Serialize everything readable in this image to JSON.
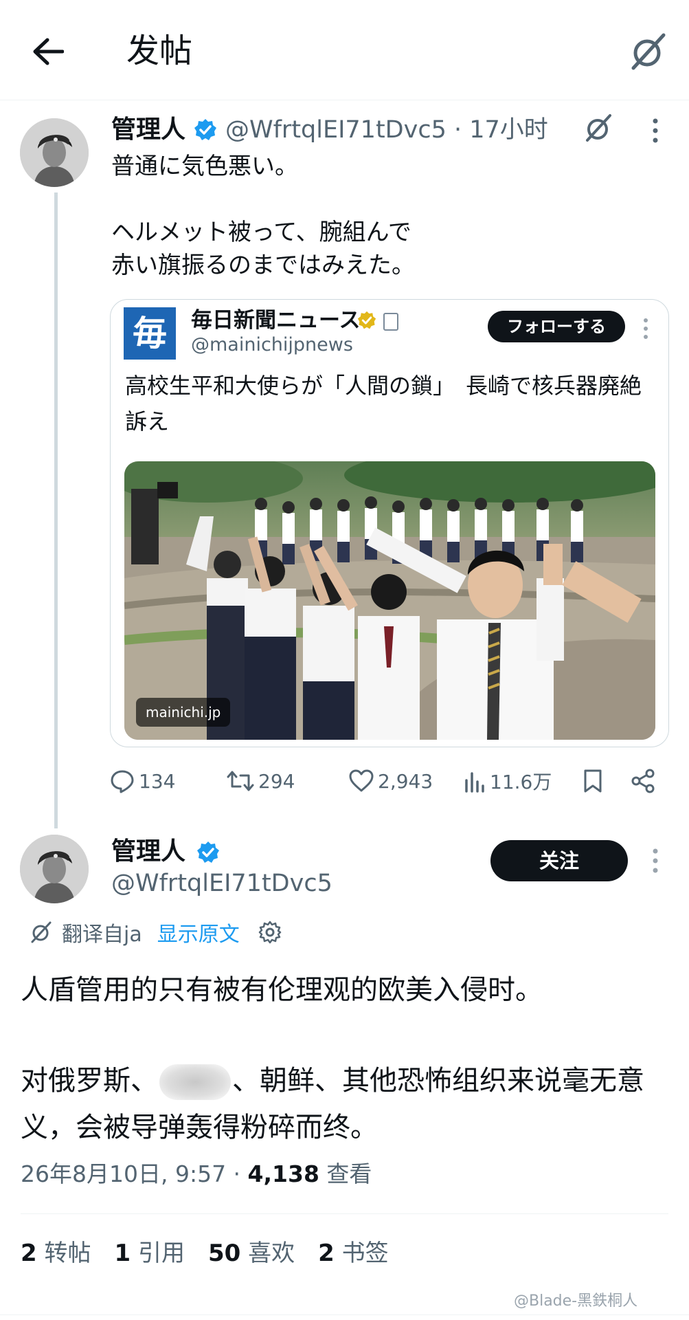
{
  "header": {
    "title": "发帖"
  },
  "tweet1": {
    "name": "管理人",
    "handle_time": "@WfrtqlEI71tDvc5 · 17小时",
    "text": "普通に気色悪い。\n\nヘルメット被って、腕組んで\n赤い旗振るのまではみえた。",
    "quote": {
      "logo_char": "毎",
      "name": "毎日新聞ニュース",
      "handle": "@mainichijpnews",
      "follow_label": "フォローする",
      "text": "高校生平和大使らが「人間の鎖」　長崎で核兵器廃絶訴え",
      "photo_source": "mainichi.jp"
    },
    "actions": {
      "replies": "134",
      "retweets": "294",
      "likes": "2,943",
      "views": "11.6万"
    }
  },
  "tweet2": {
    "name": "管理人",
    "handle": "@WfrtqlEI71tDvc5",
    "follow_label": "关注",
    "translated_from": "翻译自ja",
    "show_original": "显示原文",
    "text_line1": "人盾管用的只有被有伦理观的欧美入侵时。",
    "text_para2_before": "对俄罗斯、",
    "text_para2_after": "、朝鲜、其他恐怖组织来说毫无意义，会被导弹轰得粉碎而终。",
    "meta_time": "26年8月10日, 9:57 · ",
    "meta_views": "4,138",
    "meta_views_label": " 查看",
    "stats": [
      {
        "num": "2",
        "label": "转帖"
      },
      {
        "num": "1",
        "label": "引用"
      },
      {
        "num": "50",
        "label": "喜欢"
      },
      {
        "num": "2",
        "label": "书签"
      }
    ]
  },
  "watermark": "@Blade-黑鉄桐人",
  "colors": {
    "verified_blue": "#1d9bf0",
    "gold": "#e2b719",
    "text": "#0f1419",
    "muted": "#536471"
  }
}
